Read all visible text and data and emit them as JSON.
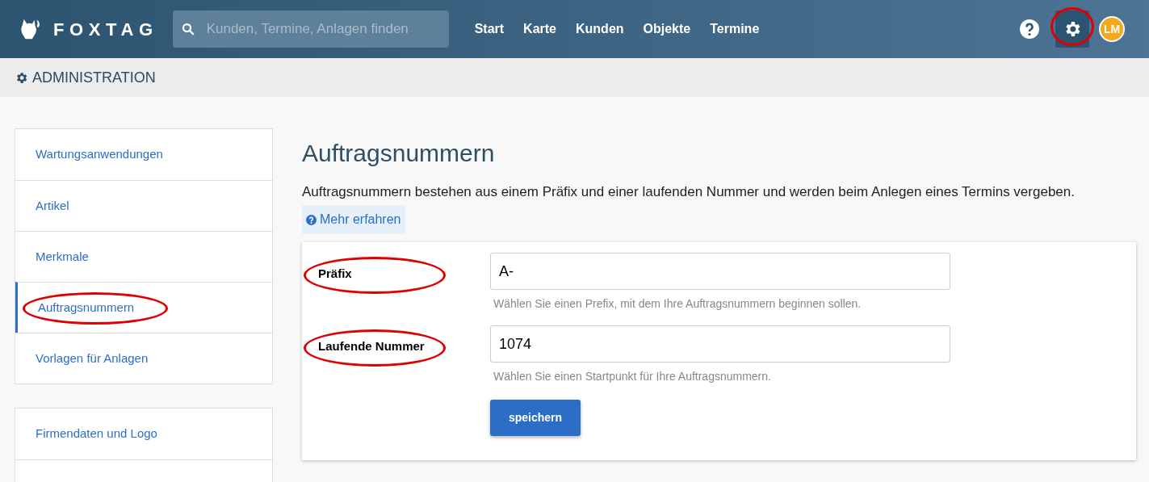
{
  "header": {
    "logo": "FOXTAG",
    "search": {
      "placeholder": "Kunden, Termine, Anlagen finden"
    },
    "nav": [
      {
        "label": "Start",
        "selected": false
      },
      {
        "label": "Karte",
        "selected": false
      },
      {
        "label": "Kunden",
        "selected": false
      },
      {
        "label": "Objekte",
        "selected": false
      },
      {
        "label": "Termine",
        "selected": false
      }
    ],
    "settings": {
      "selected": true,
      "circled": true
    },
    "avatar": {
      "initials": "LM"
    }
  },
  "breadcrumb": "ADMINISTRATION",
  "sidebar": [
    {
      "items": [
        {
          "label": "Wartungsanwendungen",
          "selected": false,
          "circled": false
        },
        {
          "label": "Artikel",
          "selected": false,
          "circled": false
        },
        {
          "label": "Merkmale",
          "selected": false,
          "circled": false
        },
        {
          "label": "Auftragsnummern",
          "selected": true,
          "circled": true
        },
        {
          "label": "Vorlagen für Anlagen",
          "selected": false,
          "circled": false
        }
      ]
    },
    {
      "items": [
        {
          "label": "Firmendaten und Logo",
          "selected": false,
          "circled": false
        },
        {
          "selected": false,
          "circled": false
        }
      ]
    }
  ],
  "main": {
    "title": "Auftragsnummern",
    "description": "Auftragsnummern bestehen aus einem Präfix und einer laufenden Nummer und werden beim Anlegen eines Termins vergeben.",
    "link": "Mehr erfahren",
    "fields": [
      {
        "label": "Präfix",
        "value": "A-",
        "help": "Wählen Sie einen Prefix, mit dem Ihre Auftragsnummern beginnen sollen.",
        "circled": true
      },
      {
        "label": "Laufende Nummer",
        "value": "1074",
        "help": "Wählen Sie einen Startpunkt für Ihre Auftragsnummern.",
        "circled": true
      }
    ],
    "button": "speichern"
  }
}
